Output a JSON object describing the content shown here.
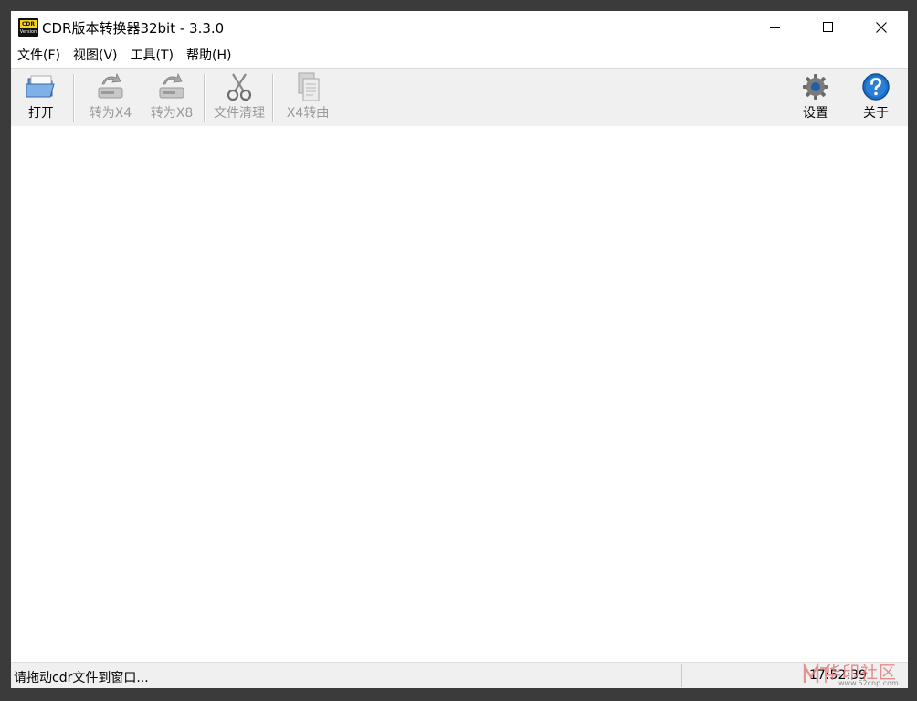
{
  "window": {
    "title": "CDR版本转换器32bit - 3.3.0",
    "icon_top": "CDR",
    "icon_bottom": "Version"
  },
  "menu": [
    {
      "label": "文件(F)"
    },
    {
      "label": "视图(V)"
    },
    {
      "label": "工具(T)"
    },
    {
      "label": "帮助(H)"
    }
  ],
  "toolbar": {
    "open": {
      "label": "打开",
      "icon": "folder-open-icon"
    },
    "to_x4": {
      "label": "转为X4",
      "icon": "drive-arrow-icon"
    },
    "to_x8": {
      "label": "转为X8",
      "icon": "drive-arrow-icon"
    },
    "clean": {
      "label": "文件清理",
      "icon": "scissors-icon"
    },
    "x4_curve": {
      "label": "X4转曲",
      "icon": "documents-copy-icon"
    },
    "settings": {
      "label": "设置",
      "icon": "gear-icon"
    },
    "about": {
      "label": "关于",
      "icon": "help-icon"
    }
  },
  "status": {
    "message": "请拖动cdr文件到窗口...",
    "time": "17:52:39"
  },
  "watermark": {
    "text": "华印社区",
    "url": "www.52cnp.com"
  },
  "colors": {
    "icon_yellow": "#f6d21a",
    "toolbar_bg": "#f0f0f0",
    "disabled_text": "#9a9a9a",
    "help_blue": "#1e6fc4",
    "gear_blue": "#1e5fa8"
  }
}
